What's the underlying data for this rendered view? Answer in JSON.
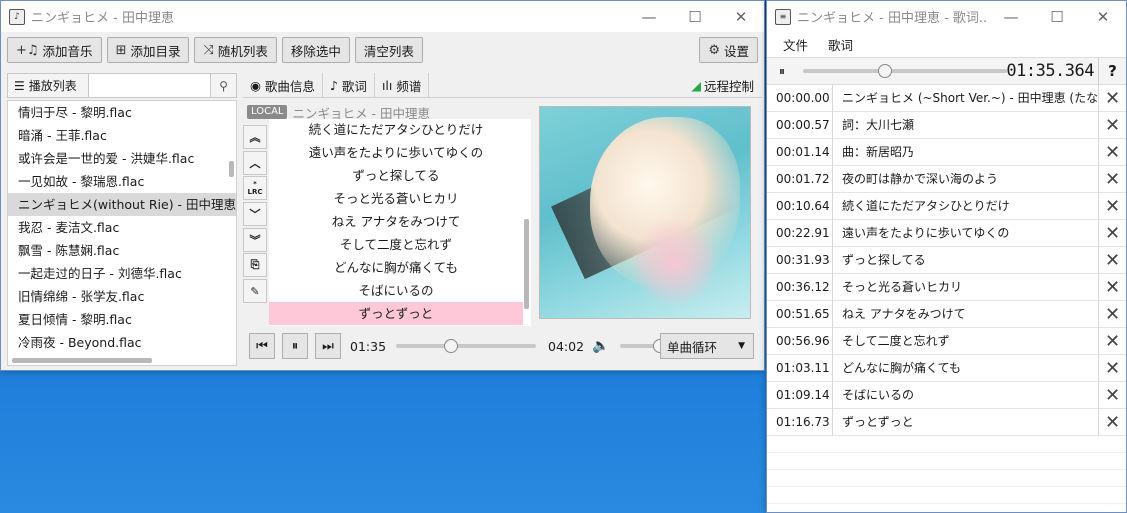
{
  "player": {
    "title": "ニンギョヒメ - 田中理恵",
    "toolbar": {
      "add_music": "添加音乐",
      "add_folder": "添加目录",
      "shuffle": "随机列表",
      "remove_selected": "移除选中",
      "clear_list": "清空列表",
      "settings": "设置"
    },
    "playlist": {
      "label": "播放列表",
      "search_value": "",
      "items": [
        {
          "name": "情归于尽 - 黎明.flac",
          "selected": false
        },
        {
          "name": "暗涌 - 王菲.flac",
          "selected": false
        },
        {
          "name": "或许会是一世的爱 - 洪婕华.flac",
          "selected": false
        },
        {
          "name": "一见如故 - 黎瑞恩.flac",
          "selected": false
        },
        {
          "name": "ニンギョヒメ(without Rie) - 田中理恵",
          "selected": true
        },
        {
          "name": "我忍 - 麦洁文.flac",
          "selected": false
        },
        {
          "name": "飘雪 - 陈慧娴.flac",
          "selected": false
        },
        {
          "name": "一起走过的日子 - 刘德华.flac",
          "selected": false
        },
        {
          "name": "旧情绵绵 - 张学友.flac",
          "selected": false
        },
        {
          "name": "夏日倾情 - 黎明.flac",
          "selected": false
        },
        {
          "name": "冷雨夜 - Beyond.flac",
          "selected": false
        }
      ]
    },
    "tabs": {
      "song_info": "歌曲信息",
      "lyrics": "歌词",
      "spectrum": "频谱",
      "remote": "远程控制"
    },
    "now_playing": {
      "source_badge": "LOCAL",
      "title": "ニンギョヒメ - 田中理恵"
    },
    "lyrics_view": [
      "続く道にただアタシひとりだけ",
      "遠い声をたよりに歩いてゆくの",
      "ずっと探してる",
      "そっと光る蒼いヒカリ",
      "ねえ アナタをみつけて",
      "そして二度と忘れず",
      "どんなに胸が痛くても",
      "そばにいるの",
      "ずっとずっと"
    ],
    "lyrics_current_index": 8,
    "side_buttons": [
      "⏶⏶",
      "⏶",
      "*LRC",
      "⏷",
      "⏷⏷",
      "file-icon",
      "edit-icon"
    ],
    "controls": {
      "elapsed": "01:35",
      "total": "04:02",
      "progress": 0.39,
      "volume": 1.0,
      "mode": "单曲循环"
    }
  },
  "lyric_editor": {
    "title": "ニンギョヒメ - 田中理恵 - 歌词...",
    "menu": {
      "file": "文件",
      "lyrics": "歌词"
    },
    "time_display": "01:35.364",
    "progress": 0.4,
    "help": "?",
    "rows": [
      {
        "time": "00:00.00",
        "text": "ニンギョヒメ (~Short Ver.~) - 田中理恵 (たなか"
      },
      {
        "time": "00:00.57",
        "text": "詞：大川七瀬"
      },
      {
        "time": "00:01.14",
        "text": "曲：新居昭乃"
      },
      {
        "time": "00:01.72",
        "text": "夜の町は静かで深い海のよう"
      },
      {
        "time": "00:10.64",
        "text": "続く道にただアタシひとりだけ"
      },
      {
        "time": "00:22.91",
        "text": "遠い声をたよりに歩いてゆくの"
      },
      {
        "time": "00:31.93",
        "text": "ずっと探してる"
      },
      {
        "time": "00:36.12",
        "text": "そっと光る蒼いヒカリ"
      },
      {
        "time": "00:51.65",
        "text": "ねえ アナタをみつけて"
      },
      {
        "time": "00:56.96",
        "text": "そして二度と忘れず"
      },
      {
        "time": "01:03.11",
        "text": "どんなに胸が痛くても"
      },
      {
        "time": "01:09.14",
        "text": "そばにいるの"
      },
      {
        "time": "01:16.73",
        "text": "ずっとずっと"
      }
    ]
  }
}
